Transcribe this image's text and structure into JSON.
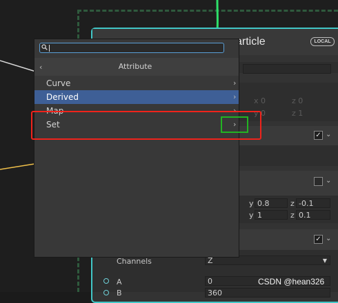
{
  "node": {
    "title": "article",
    "badge": "LOCAL",
    "faint_row1": [
      "x 0",
      "z 0"
    ],
    "faint_row2": [
      "y 0",
      "z 1"
    ],
    "vec_row1": {
      "y_label": "y",
      "y_value": "0.8",
      "z_label": "z",
      "z_value": "-0.1"
    },
    "vec_row2": {
      "y_label": "y",
      "y_value": "1",
      "z_label": "z",
      "z_value": "0.1"
    },
    "channels_label": "Channels",
    "channels_value": "Z",
    "port_a_label": "A",
    "port_a_value": "0",
    "port_b_label": "B",
    "port_b_value": "360",
    "check_glyph": "✓"
  },
  "popup": {
    "search_value": "",
    "title": "Attribute",
    "items": [
      {
        "label": "Curve"
      },
      {
        "label": "Derived"
      },
      {
        "label": "Map"
      },
      {
        "label": "Set"
      }
    ],
    "selected_index": 1
  },
  "colors": {
    "node_border": "#41c7c7",
    "selection": "#3e5f96",
    "highlight_red": "#f0231b",
    "highlight_green": "#22b422"
  },
  "icons": {
    "search": "search-icon",
    "back": "chevron-left-icon",
    "submenu": "chevron-right-icon",
    "collapse": "chevron-down-icon"
  },
  "watermark": "CSDN @hean326"
}
